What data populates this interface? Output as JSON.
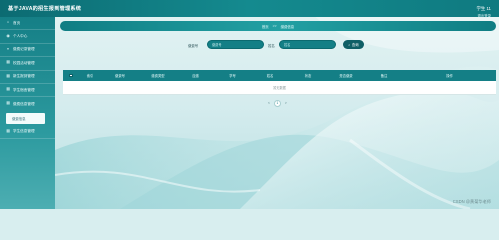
{
  "app": {
    "title": "基于JAVA的招生报到管理系统"
  },
  "header": {
    "user_label": "学生 11",
    "logout": "退出登录"
  },
  "sidebar": {
    "items": [
      {
        "label": "首页",
        "icon": "home-icon"
      },
      {
        "label": "个人中心",
        "icon": "user-icon"
      },
      {
        "label": "缴费记录管理",
        "icon": "list-icon"
      },
      {
        "label": "校园活动管理",
        "icon": "calendar-icon"
      },
      {
        "label": "新生报到管理",
        "icon": "grid-icon"
      },
      {
        "label": "学生宿舍管理",
        "icon": "grid-icon"
      },
      {
        "label": "缴费信息管理",
        "icon": "grid-icon"
      }
    ],
    "submenu_label": "缴费信息",
    "last_item": {
      "label": "学生信息管理",
      "icon": "grid-icon"
    }
  },
  "breadcrumb": {
    "home": "首页",
    "sep": ">>",
    "current": "缴费信息"
  },
  "search": {
    "field1_label": "缴费号",
    "field1_placeholder": "缴费号",
    "field2_label": "姓名",
    "field2_placeholder": "姓名",
    "button_label": "查询"
  },
  "table": {
    "columns": [
      "索引",
      "缴费号",
      "缴费类型",
      "应缴",
      "学号",
      "姓名",
      "状态",
      "是否缴费",
      "备注",
      "操作"
    ],
    "empty_text": "暂无数据"
  },
  "pager": {
    "prev": "<",
    "current": "1",
    "next": ">"
  },
  "watermark": "CSDN @黄菊华老师"
}
